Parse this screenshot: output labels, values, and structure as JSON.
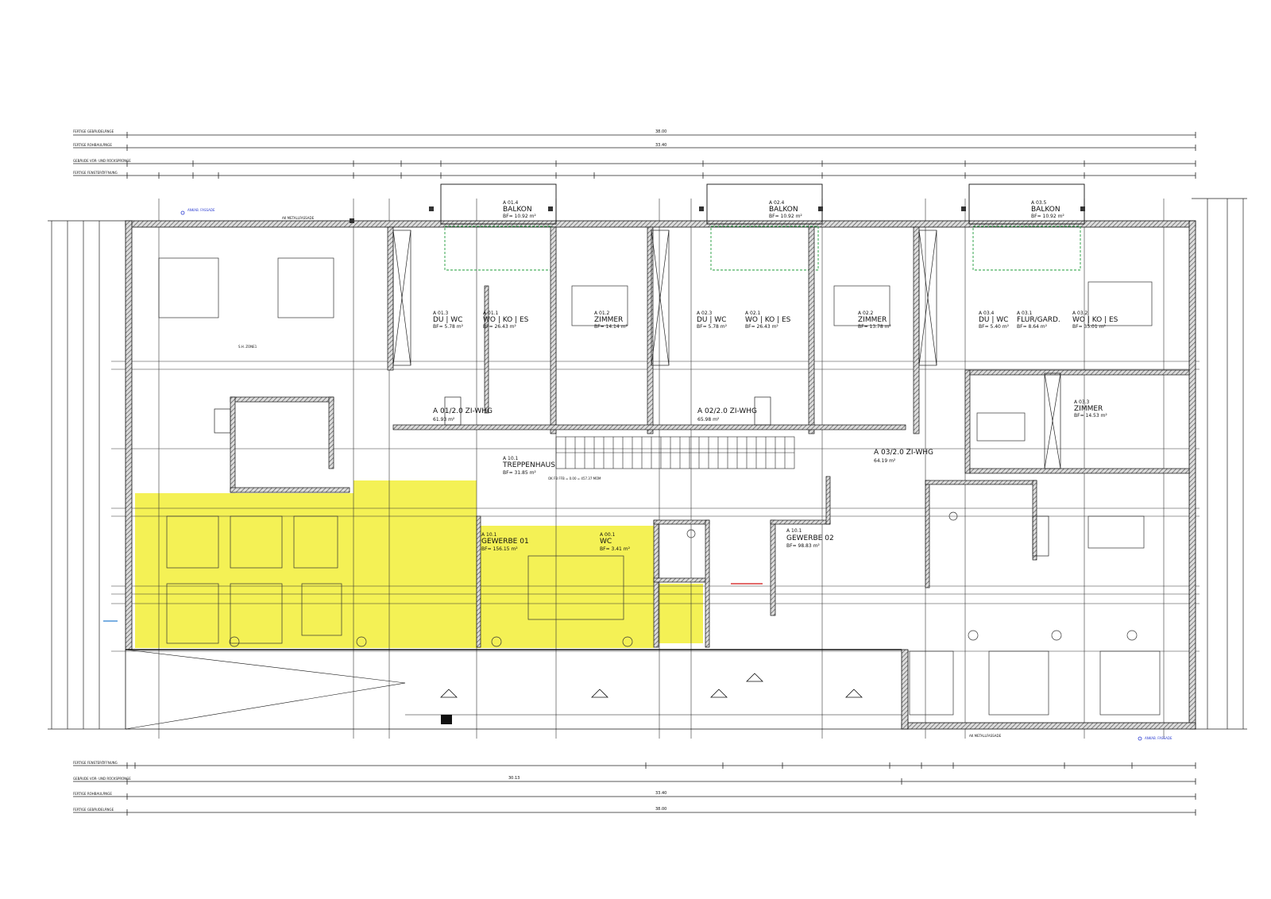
{
  "colors": {
    "line": "#111111",
    "wall_hatch": "#555555",
    "highlight": "#f2ef37",
    "green_line": "#1f9d3a",
    "blue_note": "#2a3bd1",
    "red_mark": "#d01010"
  },
  "dimension_rows": {
    "top": [
      {
        "label": "FERTIGE GEBÄUDELÄNGE",
        "total": "38.00"
      },
      {
        "label": "FERTIGE ROHBAULÄNGE",
        "total": "33.40"
      },
      {
        "label": "GEBÄUDE VOR- UND RÜCKSPRÜNGE",
        "total": ""
      },
      {
        "label": "FERTIGE FENSTERÖFFNUNG",
        "total": ""
      }
    ],
    "bottom": [
      {
        "label": "FERTIGE FENSTERÖFFNUNG",
        "total": ""
      },
      {
        "label": "GEBÄUDE VOR- UND RÜCKSPRÜNGE",
        "total": "30.13"
      },
      {
        "label": "FERTIGE ROHBAULÄNGE",
        "total": "33.40"
      },
      {
        "label": "FERTIGE GEBÄUDELÄNGE",
        "total": "38.00"
      }
    ]
  },
  "rooms": {
    "balkon_1": {
      "id": "A 01.4",
      "name": "BALKON",
      "area": "BF= 10.92 m²"
    },
    "balkon_2": {
      "id": "A 02.4",
      "name": "BALKON",
      "area": "BF= 10.92 m²"
    },
    "balkon_3": {
      "id": "A 03.5",
      "name": "BALKON",
      "area": "BF= 10.92 m²"
    },
    "a01_duwc": {
      "id": "A 01.3",
      "name": "DU | WC",
      "area": "BF= 5.78 m²"
    },
    "a01_woko": {
      "id": "A 01.1",
      "name": "WO | KO | ES",
      "area": "BF= 26.43 m²"
    },
    "a01_zimmer": {
      "id": "A 01.2",
      "name": "ZIMMER",
      "area": "BF= 14.14 m²"
    },
    "a02_duwc": {
      "id": "A 02.3",
      "name": "DU | WC",
      "area": "BF= 5.78 m²"
    },
    "a02_woko": {
      "id": "A 02.1",
      "name": "WO | KO | ES",
      "area": "BF= 26.43 m²"
    },
    "a02_zimmer": {
      "id": "A 02.2",
      "name": "ZIMMER",
      "area": "BF= 13.78 m²"
    },
    "a03_duwc": {
      "id": "A 03.4",
      "name": "DU | WC",
      "area": "BF= 5.40 m²"
    },
    "a03_flur": {
      "id": "A 03.1",
      "name": "FLUR/GARD.",
      "area": "BF= 8.64 m²"
    },
    "a03_woko": {
      "id": "A 03.2",
      "name": "WO | KO | ES",
      "area": "BF= 35.01 m²"
    },
    "a03_zimmer": {
      "id": "A 03.3",
      "name": "ZIMMER",
      "area": "BF= 14.53 m²"
    },
    "a01_whg": {
      "name": "A 01/2.0 ZI-WHG",
      "area": "61.93 m²"
    },
    "a02_whg": {
      "name": "A 02/2.0 ZI-WHG",
      "area": "65.98 m²"
    },
    "a03_whg": {
      "name": "A 03/2.0 ZI-WHG",
      "area": "64.19 m²"
    },
    "treppenhaus": {
      "id": "A 10.1",
      "name": "TREPPENHAUS",
      "area": "BF= 31.85 m²"
    },
    "gewerbe01": {
      "id": "A 10.1",
      "name": "GEWERBE 01",
      "area": "BF= 156.15 m²"
    },
    "wc": {
      "id": "A 00.1",
      "name": "WC",
      "area": "BF= 3.41 m²"
    },
    "gewerbe02": {
      "id": "A 10.1",
      "name": "GEWERBE 02",
      "area": "BF= 98.83 m²"
    }
  },
  "notes": {
    "fassade_top": "ANKAB. FASSADE",
    "fassade_bottom": "ANKAB. FASSADE",
    "metall_top": "AK METALLFASSADE",
    "metall_bottom": "AK METALLFASSADE",
    "ok_ffb": "OK FB FFB = 0.00 = 457.37 MÜM",
    "zone_label": "S.H. ZONE1"
  }
}
